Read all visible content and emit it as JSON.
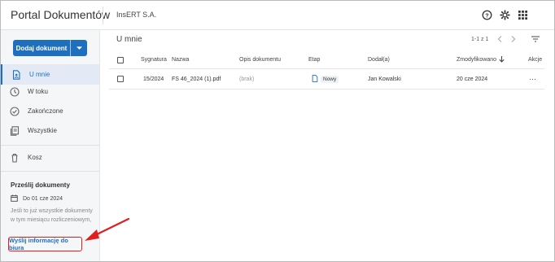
{
  "app": {
    "title": "Portal Dokumentów",
    "company": "InsERT S.A."
  },
  "topbar": {
    "icons": [
      "help-icon",
      "gear-icon",
      "apps-grid-icon"
    ]
  },
  "sidebar": {
    "add_button": "Dodaj dokument",
    "items": [
      {
        "label": "U mnie",
        "icon": "document-user-icon",
        "active": true
      },
      {
        "label": "W toku",
        "icon": "clock-icon"
      },
      {
        "label": "Zakończone",
        "icon": "check-circle-icon"
      },
      {
        "label": "Wszystkie",
        "icon": "documents-icon"
      },
      {
        "label": "Kosz",
        "icon": "trash-icon"
      }
    ],
    "send": {
      "title": "Prześlij dokumenty",
      "date": "Do 01 cze 2024",
      "info": "Jeśli to już wszystkie dokumenty w tym miesiącu rozliczeniowym,",
      "link": "Wyślij informację do biura"
    }
  },
  "main": {
    "title": "U mnie",
    "pager": "1-1 z 1",
    "columns": {
      "signature": "Sygnatura",
      "name": "Nazwa",
      "description": "Opis dokumentu",
      "stage": "Etap",
      "added_by": "Dodał(a)",
      "modified": "Zmodyfikowano",
      "actions": "Akcje"
    },
    "rows": [
      {
        "signature": "15/2024",
        "name": "FS 46_2024 (1).pdf",
        "description": "(brak)",
        "stage": "Nowy",
        "added_by": "Jan Kowalski",
        "modified": "20 cze 2024",
        "actions": "⋯"
      }
    ]
  },
  "colors": {
    "accent": "#1f6fbf",
    "highlight": "#e02020"
  }
}
